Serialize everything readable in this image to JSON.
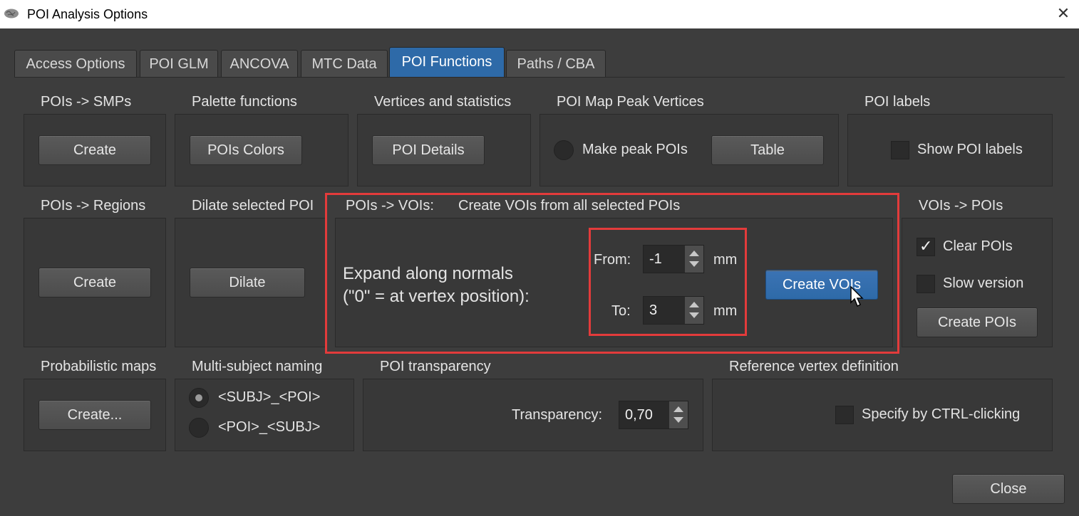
{
  "window": {
    "title": "POI Analysis Options",
    "close_glyph": "✕"
  },
  "tabs": [
    "Access Options",
    "POI GLM",
    "ANCOVA",
    "MTC Data",
    "POI Functions",
    "Paths / CBA"
  ],
  "active_tab": "POI Functions",
  "groups": {
    "pois_smps": {
      "title": "POIs -> SMPs",
      "button": "Create"
    },
    "palette": {
      "title": "Palette functions",
      "button": "POIs Colors"
    },
    "vertices": {
      "title": "Vertices and statistics",
      "button": "POI Details"
    },
    "peak": {
      "title": "POI Map Peak Vertices",
      "radio_label": "Make peak POIs",
      "button": "Table"
    },
    "labels": {
      "title": "POI labels",
      "checkbox_label": "Show POI labels"
    },
    "regions": {
      "title": "POIs -> Regions",
      "button": "Create"
    },
    "dilate": {
      "title": "Dilate selected POI",
      "button": "Dilate"
    },
    "vois": {
      "title": "POIs -> VOIs:",
      "subtitle": "Create VOIs from all selected POIs",
      "expand_line1": "Expand along normals",
      "expand_line2": "(\"0\" = at vertex position):",
      "from_label": "From:",
      "from_value": "-1",
      "to_label": "To:",
      "to_value": "3",
      "unit": "mm",
      "button": "Create VOIs"
    },
    "vois_pois": {
      "title": "VOIs -> POIs",
      "clear_label": "Clear POIs",
      "slow_label": "Slow version",
      "button": "Create POIs"
    },
    "prob": {
      "title": "Probabilistic maps",
      "button": "Create..."
    },
    "naming": {
      "title": "Multi-subject naming",
      "option1": "<SUBJ>_<POI>",
      "option2": "<POI>_<SUBJ>"
    },
    "transparency": {
      "title": "POI transparency",
      "label": "Transparency:",
      "value": "0,70"
    },
    "reference": {
      "title": "Reference vertex definition",
      "checkbox_label": "Specify by CTRL-clicking"
    }
  },
  "footer": {
    "close_label": "Close"
  },
  "colors": {
    "accent": "#2e6aa8",
    "highlight": "#e33b3b",
    "background": "#3d3d3d"
  }
}
